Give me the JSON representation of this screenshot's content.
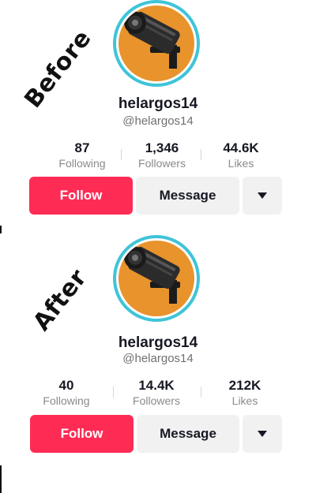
{
  "before": {
    "tag": "Before",
    "username": "helargos14",
    "handle": "@helargos14",
    "stats": [
      {
        "value": "87",
        "label": "Following"
      },
      {
        "value": "1,346",
        "label": "Followers"
      },
      {
        "value": "44.6K",
        "label": "Likes"
      }
    ],
    "buttons": {
      "follow": "Follow",
      "message": "Message"
    }
  },
  "after": {
    "tag": "After",
    "username": "helargos14",
    "handle": "@helargos14",
    "stats": [
      {
        "value": "40",
        "label": "Following"
      },
      {
        "value": "14.4K",
        "label": "Followers"
      },
      {
        "value": "212K",
        "label": "Likes"
      }
    ],
    "buttons": {
      "follow": "Follow",
      "message": "Message"
    }
  },
  "icons": {
    "avatar": "security-camera-icon",
    "more": "caret-down-icon"
  },
  "colors": {
    "follow_bg": "#fe2c55",
    "secondary_bg": "#f1f1f2",
    "avatar_ring": "#3fc4d8",
    "avatar_bg": "#e8932c"
  }
}
